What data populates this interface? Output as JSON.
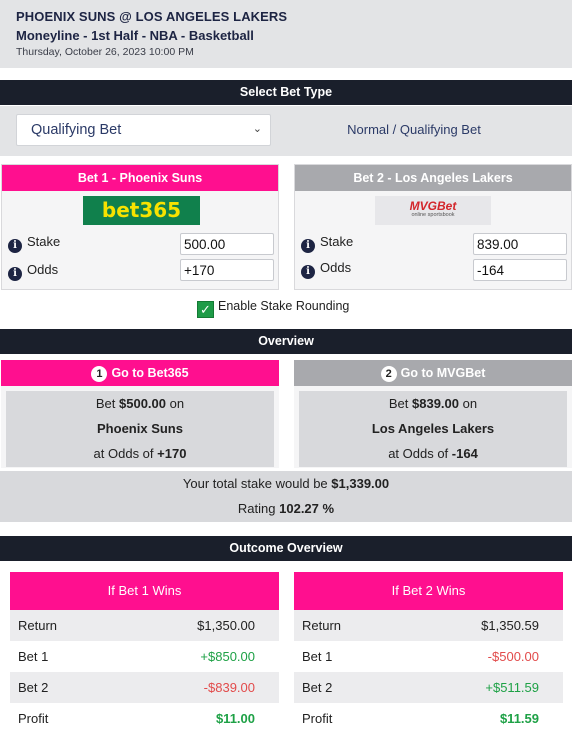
{
  "header": {
    "matchup": "PHOENIX SUNS @ LOS ANGELES LAKERS",
    "market": "Moneyline - 1st Half -  NBA - Basketball",
    "datetime": "Thursday, October 26, 2023 10:00 PM"
  },
  "bet_type": {
    "title": "Select Bet Type",
    "selected": "Qualifying Bet",
    "description": "Normal / Qualifying Bet"
  },
  "bet1": {
    "title": "Bet 1 - Phoenix Suns",
    "bookmaker_logo": "bet365",
    "stake_label": "Stake",
    "stake": "500.00",
    "odds_label": "Odds",
    "odds": "+170"
  },
  "bet2": {
    "title": "Bet 2 - Los Angeles Lakers",
    "bookmaker_logo": "MVGBet",
    "bookmaker_tagline": "online sportsbook",
    "stake_label": "Stake",
    "stake": "839.00",
    "odds_label": "Odds",
    "odds": "-164"
  },
  "rounding": {
    "label": "Enable Stake Rounding",
    "checked": true
  },
  "overview": {
    "title": "Overview",
    "go1": {
      "num": "1",
      "label": "Go to Bet365",
      "bet_prefix": "Bet ",
      "amount": "$500.00",
      "bet_suffix": " on",
      "team": "Phoenix Suns",
      "odds_prefix": "at Odds of ",
      "odds": "+170"
    },
    "go2": {
      "num": "2",
      "label": "Go to MVGBet",
      "bet_prefix": "Bet ",
      "amount": "$839.00",
      "bet_suffix": " on",
      "team": "Los Angeles Lakers",
      "odds_prefix": "at Odds of ",
      "odds": "-164"
    },
    "total_prefix": "Your total stake would be ",
    "total": "$1,339.00",
    "rating_prefix": "Rating ",
    "rating": "102.27 %"
  },
  "outcome": {
    "title": "Outcome Overview",
    "if1": {
      "head": "If Bet 1 Wins",
      "rows": [
        {
          "label": "Return",
          "value": "$1,350.00"
        },
        {
          "label": "Bet 1",
          "value": "+$850.00"
        },
        {
          "label": "Bet 2",
          "value": "-$839.00"
        },
        {
          "label": "Profit",
          "value": "$11.00"
        }
      ]
    },
    "if2": {
      "head": "If Bet 2 Wins",
      "rows": [
        {
          "label": "Return",
          "value": "$1,350.59"
        },
        {
          "label": "Bet 1",
          "value": "-$500.00"
        },
        {
          "label": "Bet 2",
          "value": "+$511.59"
        },
        {
          "label": "Profit",
          "value": "$11.59"
        }
      ]
    }
  },
  "icons": {
    "info": "info-icon",
    "dropdown": "chevron-down-icon",
    "checkbox": "checkmark-icon"
  },
  "colors": {
    "pink": "#ff0f8f",
    "dark": "#1a1f2b",
    "positive": "#1ea146",
    "negative": "#e24b4b",
    "bet365_green": "#10804c"
  }
}
